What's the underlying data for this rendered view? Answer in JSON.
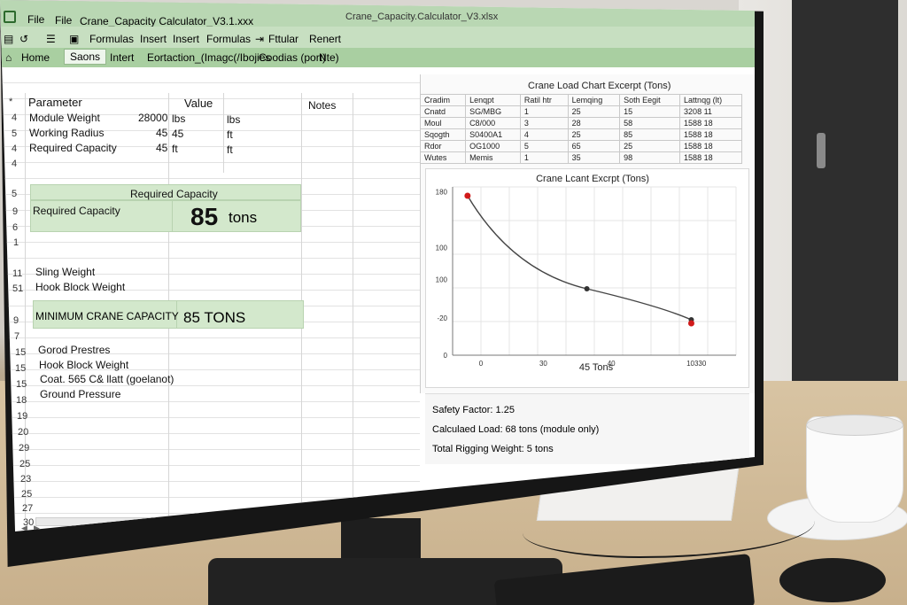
{
  "window": {
    "file_menu_1": "File",
    "file_menu_2": "File",
    "doc_name": "Crane_Capacity Calculator_V3.1.xxx",
    "title": "Crane_Capacity.Calculator_V3.xlsx",
    "controls": "— □ ×"
  },
  "ribbon": {
    "items": [
      "Formulas",
      "Insert",
      "Insert",
      "Formulas",
      "Fttular",
      "Renert"
    ]
  },
  "tabs": {
    "home": "Home",
    "active": "Saons",
    "items": [
      "Intert",
      "Eortaction_(Imagc(/Ibojies",
      "Coodias (port)",
      "Nte)"
    ]
  },
  "sheet": {
    "headers": {
      "parameter": "Parameter",
      "value": "Value",
      "notes": "Notes"
    },
    "header_rownum": "*",
    "rows": [
      {
        "n": "4",
        "param": "Module Weight",
        "v1": "28000",
        "v2": "lbs",
        "v3": "lbs"
      },
      {
        "n": "5",
        "param": "Working Radius",
        "v1": "45",
        "v2": "45",
        "v3": "ft"
      },
      {
        "n": "4",
        "param": "Required Capacity",
        "v1": "45",
        "v2": "ft",
        "v3": "ft"
      }
    ],
    "rownums_lower": [
      "4",
      "5",
      "9",
      "6",
      "1",
      "11",
      "51",
      "9",
      "7",
      "15",
      "15",
      "15",
      "18",
      "19",
      "20",
      "29",
      "25",
      "23",
      "25",
      "27",
      "30"
    ],
    "required_capacity_header": "Required Capacity",
    "required_capacity_label": "Required Capacity",
    "required_capacity_value": "85",
    "required_capacity_unit": "tons",
    "sling_weight": "Sling Weight",
    "hook_block_weight": "Hook Block Weight",
    "min_crane_label": "MINIMUM CRANE CAPACITY",
    "min_crane_value": "85 TONS",
    "lower_items": [
      "Gorod Prestres",
      "Hook Block Weight",
      "Coat. 565 C& llatt (goelanot)",
      "Ground Pressure"
    ]
  },
  "load_chart": {
    "title": "Crane Load Chart Excerpt (Tons)",
    "columns": [
      "Cradim",
      "Lenqpt",
      "Ratil htr",
      "Lemqing",
      "Soth Eegit",
      "Lattnqg (lt)"
    ],
    "rows": [
      [
        "Cnatd",
        "SG/MBG",
        "1",
        "25",
        "15",
        "3208 11"
      ],
      [
        "Moul",
        "C8/000",
        "3",
        "28",
        "58",
        "1588 18"
      ],
      [
        "Sqogth",
        "S0400A1",
        "4",
        "25",
        "85",
        "1588 18"
      ],
      [
        "Rdor",
        "OG1000",
        "5",
        "65",
        "25",
        "1588 18"
      ],
      [
        "Wutes",
        "Memis",
        "1",
        "35",
        "98",
        "1588 18"
      ]
    ]
  },
  "chart_data": {
    "type": "line",
    "title": "Crane Lcant Excrpt (Tons)",
    "xlabel": "45 Tons",
    "x_tick_labels": [
      "0",
      "30",
      "40",
      "10330"
    ],
    "y_tick_labels": [
      "180",
      "100",
      "100",
      "-20",
      "0"
    ],
    "series": [
      {
        "points": [
          [
            0,
            180
          ],
          [
            40,
            75
          ],
          [
            75,
            40
          ]
        ]
      }
    ],
    "highlight_points": [
      [
        0,
        180
      ],
      [
        75,
        36
      ]
    ],
    "xlim": [
      -5,
      90
    ],
    "ylim": [
      0,
      190
    ],
    "grid": true
  },
  "summary": {
    "safety_factor": "Safety Factor: 1.25",
    "calculated_load": "Calculaed Load: 68 tons (module only)",
    "total_rigging": "Total Rigging Weight: 5 tons"
  },
  "colors": {
    "accent_green": "#d3e8cc",
    "ribbon_green": "#b9d7b3",
    "point_red": "#d11a1a"
  }
}
